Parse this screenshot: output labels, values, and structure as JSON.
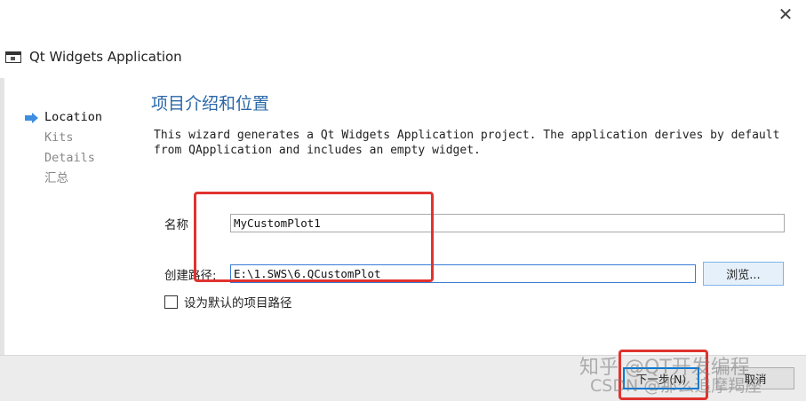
{
  "window": {
    "title": "Qt Widgets Application",
    "close_glyph": "✕"
  },
  "steps": [
    {
      "label": "Location",
      "active": true
    },
    {
      "label": "Kits",
      "active": false
    },
    {
      "label": "Details",
      "active": false
    },
    {
      "label": "汇总",
      "active": false
    }
  ],
  "page": {
    "section_title": "项目介绍和位置",
    "description": "This wizard generates a Qt Widgets Application project. The application derives by default\nfrom QApplication and includes an empty widget."
  },
  "form": {
    "name_label": "名称",
    "name_value": "MyCustomPlot1",
    "path_label": "创建路径:",
    "path_value": "E:\\1.SWS\\6.QCustomPlot",
    "browse_label": "浏览...",
    "default_path_label": "设为默认的项目路径",
    "default_path_checked": false
  },
  "footer": {
    "next_label": "下一步(N)",
    "cancel_label": "取消"
  },
  "watermark": {
    "line1": "知乎 @QT开发编程",
    "line2": "CSDN @那么追摩羯座"
  },
  "colors": {
    "accent": "#2a67a8",
    "highlight": "#e0332f",
    "arrow": "#3d8de0"
  }
}
